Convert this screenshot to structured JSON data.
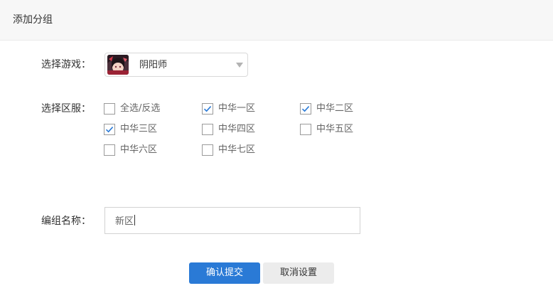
{
  "header": {
    "title": "添加分组"
  },
  "game": {
    "label": "选择游戏：",
    "selected": "阴阳师",
    "icon": "game-avatar-icon"
  },
  "servers": {
    "label": "选择区服：",
    "options": [
      {
        "label": "全选/反选",
        "checked": false
      },
      {
        "label": "中华一区",
        "checked": true
      },
      {
        "label": "中华二区",
        "checked": true
      },
      {
        "label": "中华三区",
        "checked": true
      },
      {
        "label": "中华四区",
        "checked": false
      },
      {
        "label": "中华五区",
        "checked": false
      },
      {
        "label": "中华六区",
        "checked": false
      },
      {
        "label": "中华七区",
        "checked": false
      }
    ]
  },
  "group_name": {
    "label": "编组名称：",
    "value": "新区"
  },
  "actions": {
    "submit": "确认提交",
    "cancel": "取消设置"
  },
  "colors": {
    "accent": "#2a7ad6",
    "check": "#2a7ad6",
    "header_bg": "#f7f7f7",
    "cancel_bg": "#ececec"
  }
}
